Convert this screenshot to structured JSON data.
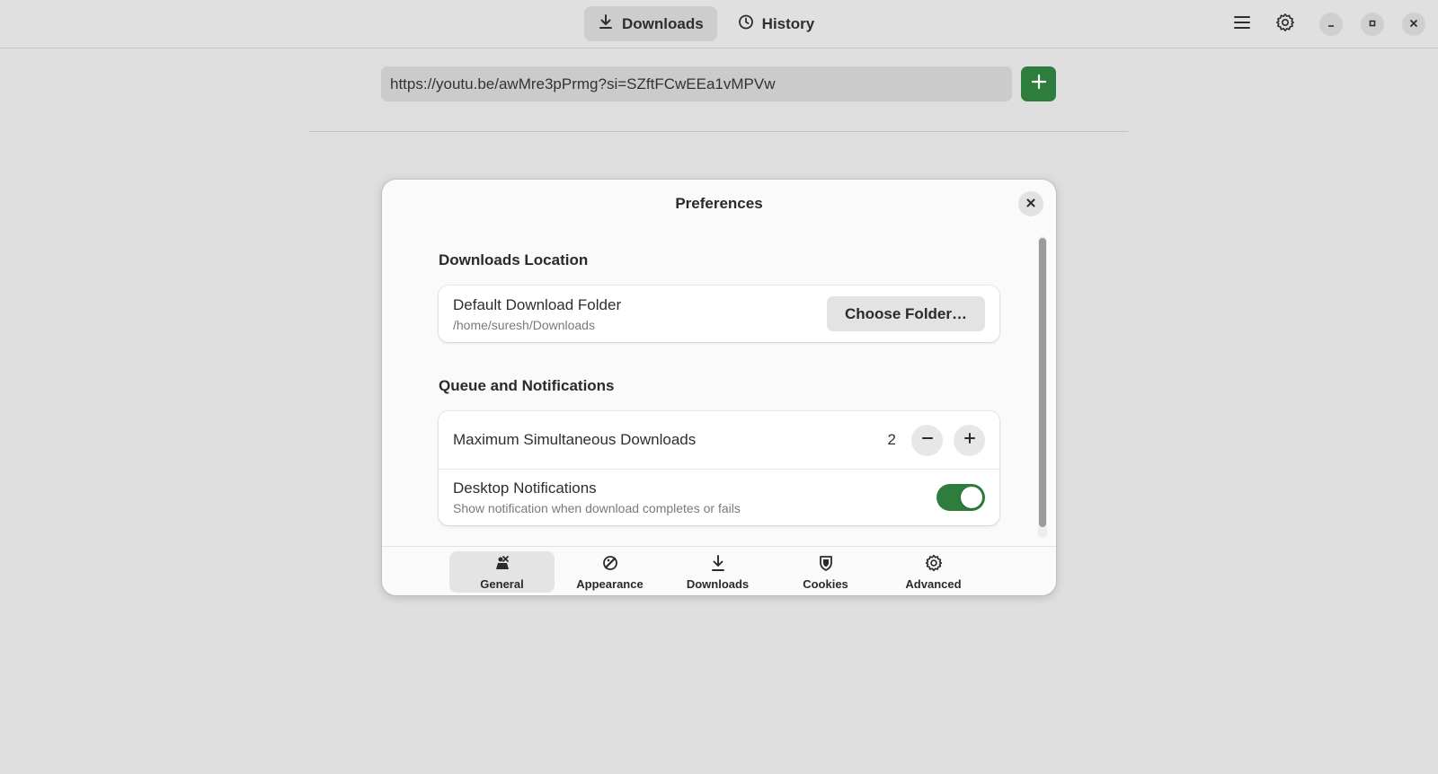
{
  "header": {
    "tabs": [
      {
        "label": "Downloads",
        "icon": "download-icon",
        "active": true
      },
      {
        "label": "History",
        "icon": "clock-icon",
        "active": false
      }
    ],
    "actions": [
      "menu-icon",
      "gear-icon"
    ],
    "window_controls": [
      "minimize-icon",
      "maximize-icon",
      "close-icon"
    ]
  },
  "url_bar": {
    "value": "https://youtu.be/awMre3pPrmg?si=SZftFCwEEa1vMPVw",
    "add_icon": "plus-icon"
  },
  "preferences": {
    "title": "Preferences",
    "sections": {
      "location": {
        "title": "Downloads Location",
        "folder_label": "Default Download Folder",
        "folder_path": "/home/suresh/Downloads",
        "choose_button": "Choose Folder…"
      },
      "queue": {
        "title": "Queue and Notifications",
        "max_label": "Maximum Simultaneous Downloads",
        "max_value": "2",
        "notify_label": "Desktop Notifications",
        "notify_desc": "Show notification when download completes or fails",
        "notify_enabled": true
      }
    },
    "pages": [
      {
        "label": "General",
        "icon": "general-icon",
        "active": true
      },
      {
        "label": "Appearance",
        "icon": "palette-icon",
        "active": false
      },
      {
        "label": "Downloads",
        "icon": "download-icon",
        "active": false
      },
      {
        "label": "Cookies",
        "icon": "shield-icon",
        "active": false
      },
      {
        "label": "Advanced",
        "icon": "gear-icon",
        "active": false
      }
    ]
  },
  "colors": {
    "accent": "#2f7d3c",
    "background": "#dedede",
    "dialog": "#fafafa"
  }
}
